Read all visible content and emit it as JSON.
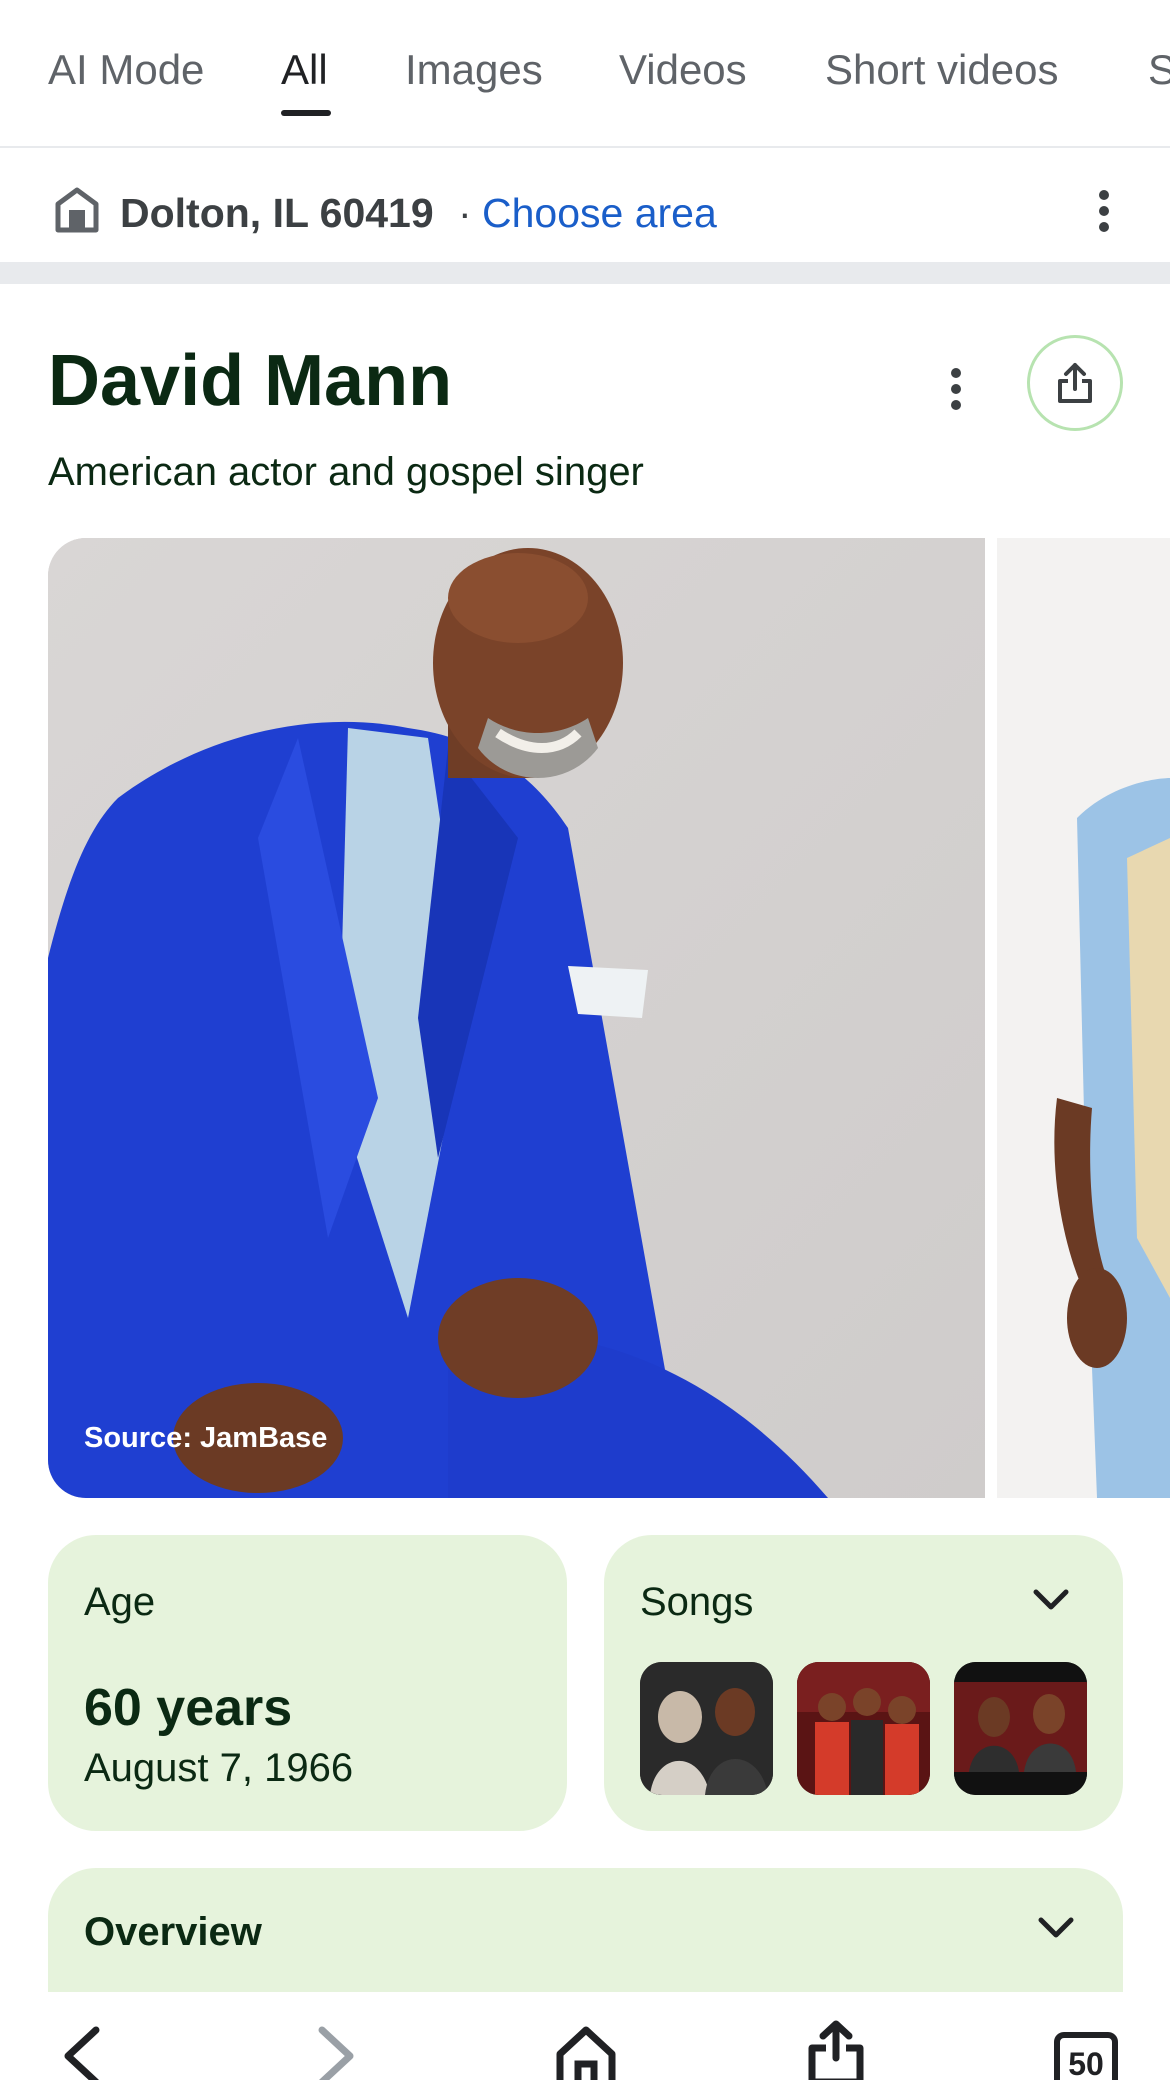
{
  "tabs": [
    {
      "label": "AI Mode",
      "active": false
    },
    {
      "label": "All",
      "active": true
    },
    {
      "label": "Images",
      "active": false
    },
    {
      "label": "Videos",
      "active": false
    },
    {
      "label": "Short videos",
      "active": false
    },
    {
      "label": "S",
      "active": false
    }
  ],
  "location": {
    "icon": "store-icon",
    "city": "Dolton, IL 60419",
    "separator": "·",
    "link": "Choose area"
  },
  "entity": {
    "title": "David Mann",
    "subtitle": "American actor and gospel singer",
    "image_source": "Source: JamBase"
  },
  "cards": {
    "age": {
      "label": "Age",
      "value": "60 years",
      "date": "August 7, 1966"
    },
    "songs": {
      "label": "Songs"
    },
    "overview": {
      "label": "Overview"
    }
  },
  "bottom_nav": {
    "tabs_count": "50",
    "icons": [
      "back-icon",
      "forward-icon",
      "home-icon",
      "share-icon",
      "tabs-icon"
    ]
  },
  "colors": {
    "card_bg": "#e6f3dc",
    "link": "#1a5ec9",
    "title_text": "#0b2913",
    "share_ring": "#b7e3b0"
  }
}
